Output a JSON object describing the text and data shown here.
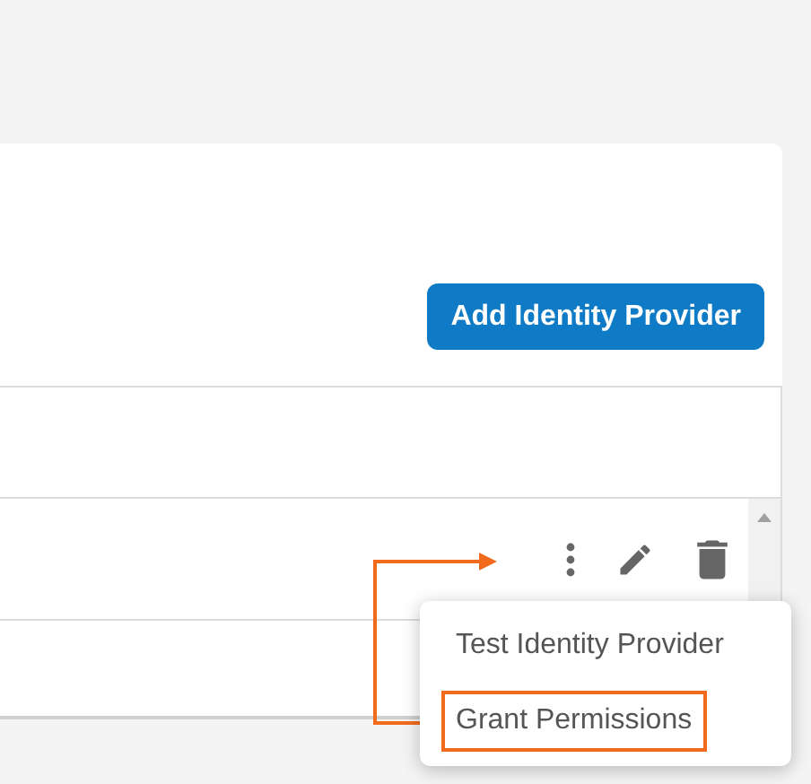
{
  "toolbar": {
    "button": "Add Identity Provider"
  },
  "menu": {
    "items": [
      {
        "label": "Test Identity Provider",
        "highlighted": false
      },
      {
        "label": "Grant Permissions",
        "highlighted": true
      }
    ]
  }
}
